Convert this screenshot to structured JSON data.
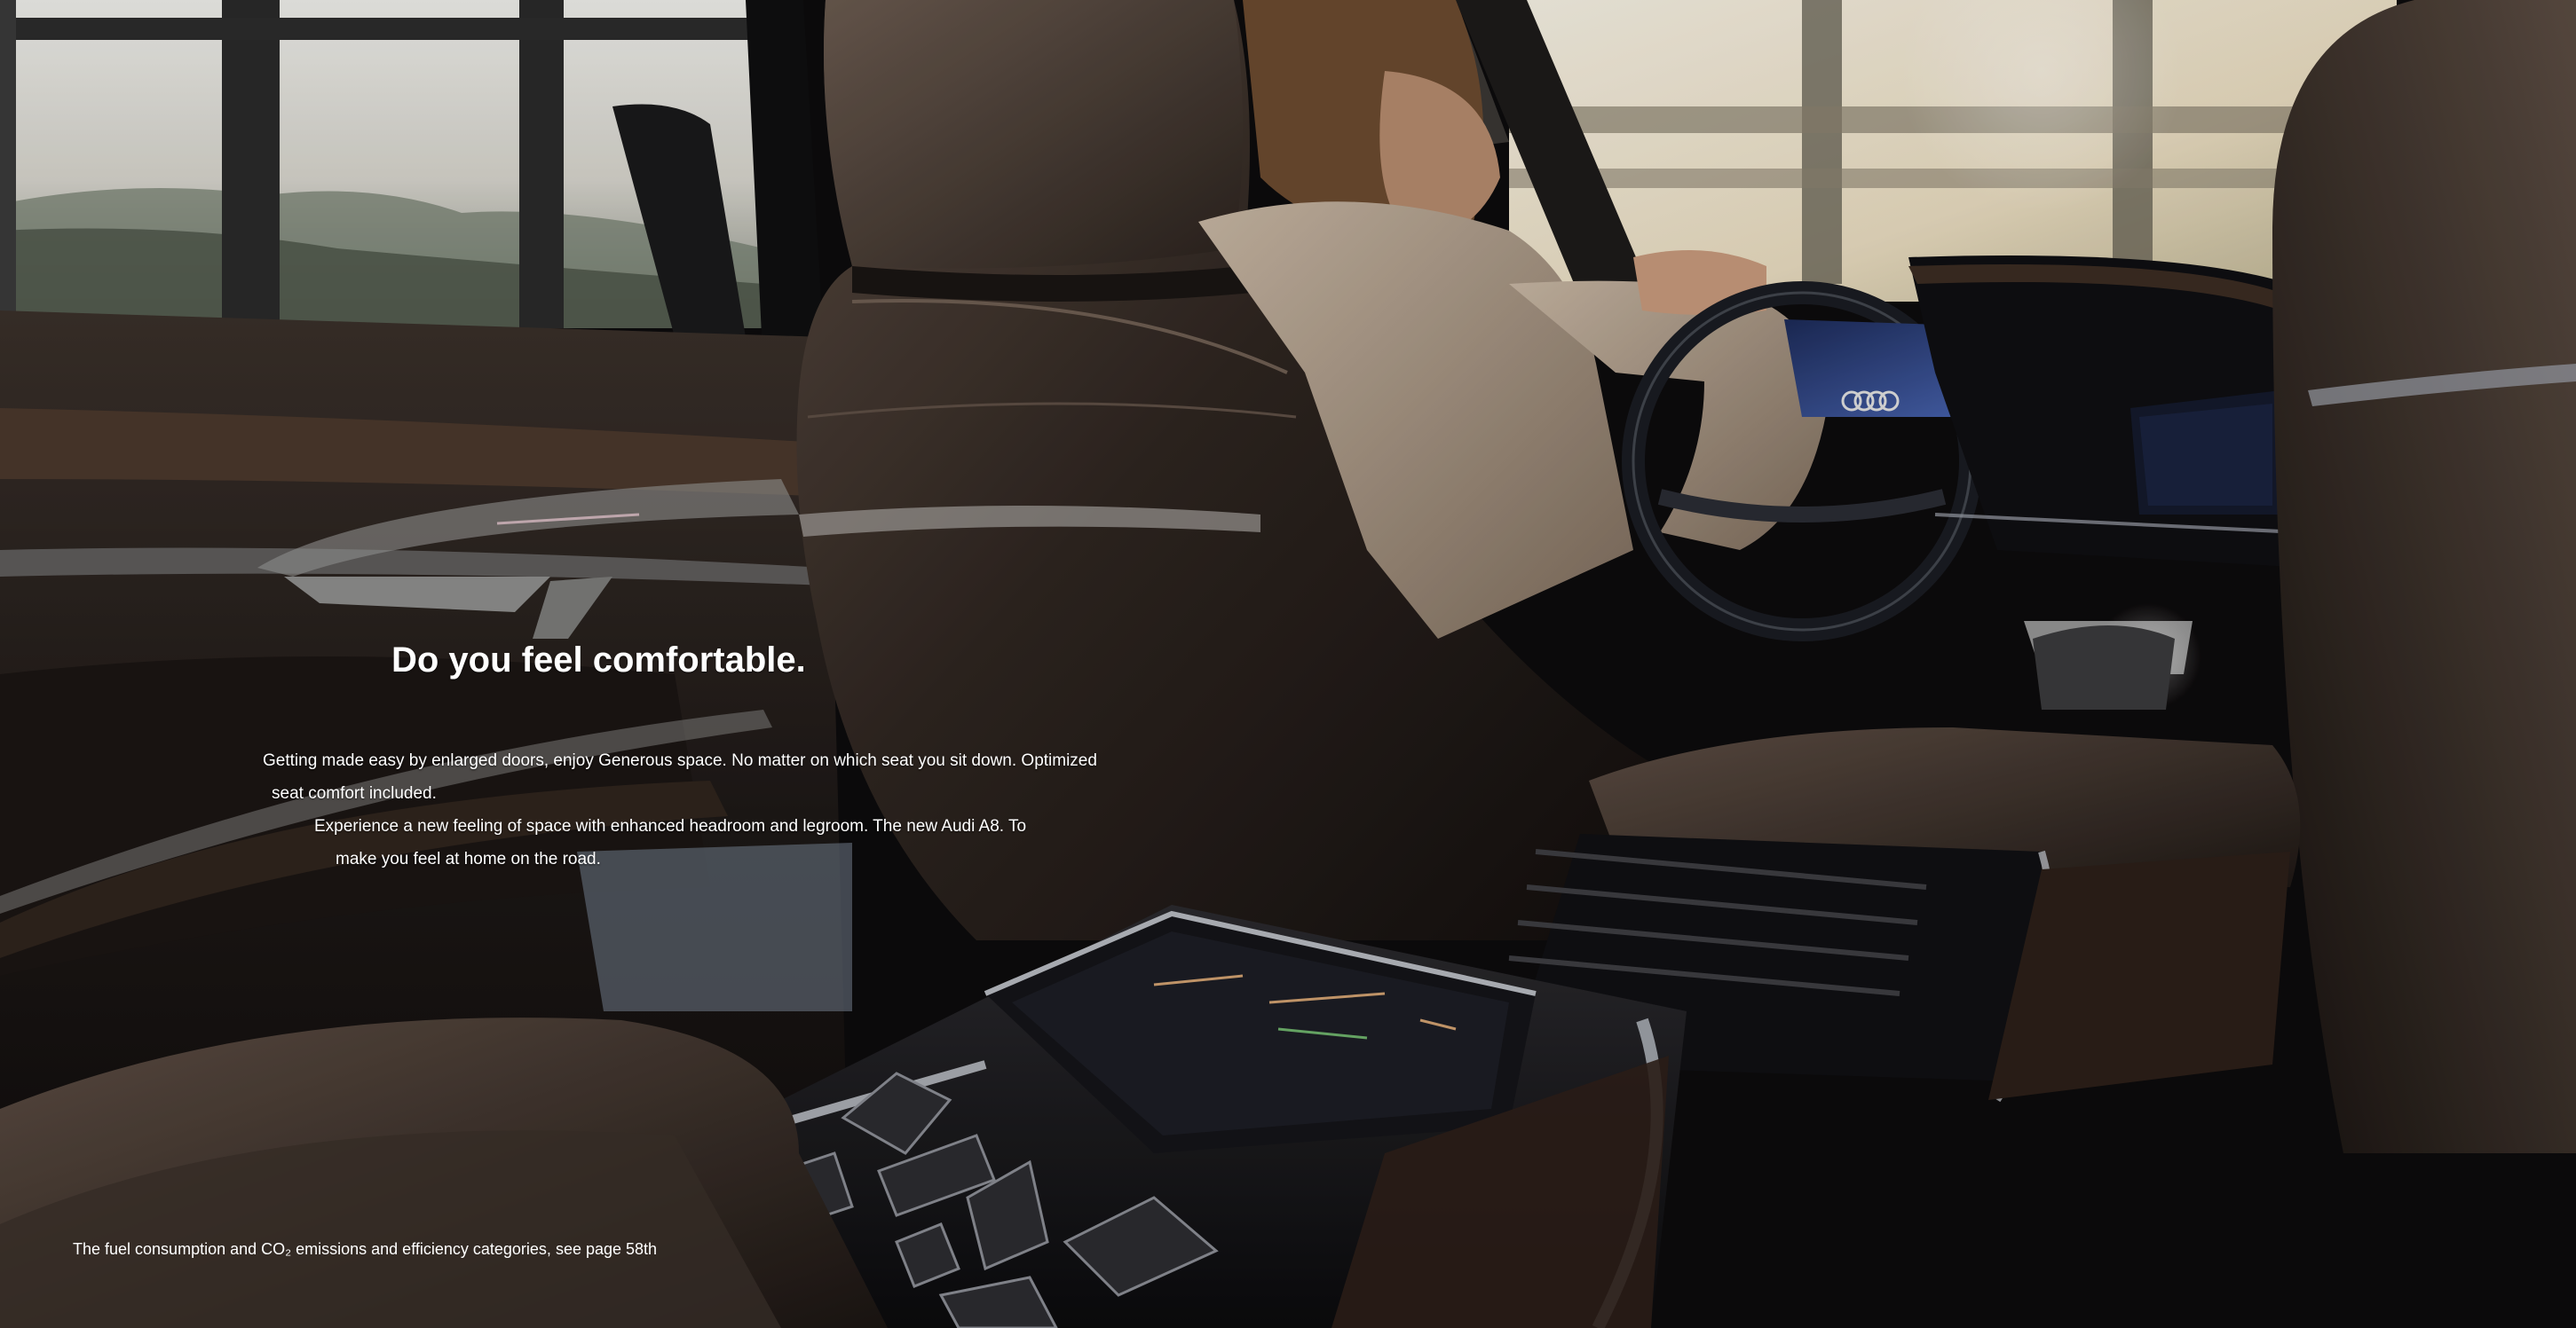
{
  "page": {
    "headline": "Do you feel comfortable.",
    "body_lines": [
      "Getting made easy by enlarged doors, enjoy Generous space. No matter on which seat you sit down. Optimized",
      "seat comfort included.",
      "Experience a new feeling of space with enhanced headroom and legroom. The new Audi A8. To",
      "make you feel at home on the road."
    ],
    "footnote": "The fuel consumption and CO₂ emissions and efficiency categories, see page 58th"
  },
  "colors": {
    "text": "#ffffff",
    "leather_dark": "#2a221d",
    "leather_mid": "#4a3d34",
    "window_light": "#e8e6df",
    "screen_blue": "#3a5aa8",
    "wood": "#3b2a20"
  }
}
